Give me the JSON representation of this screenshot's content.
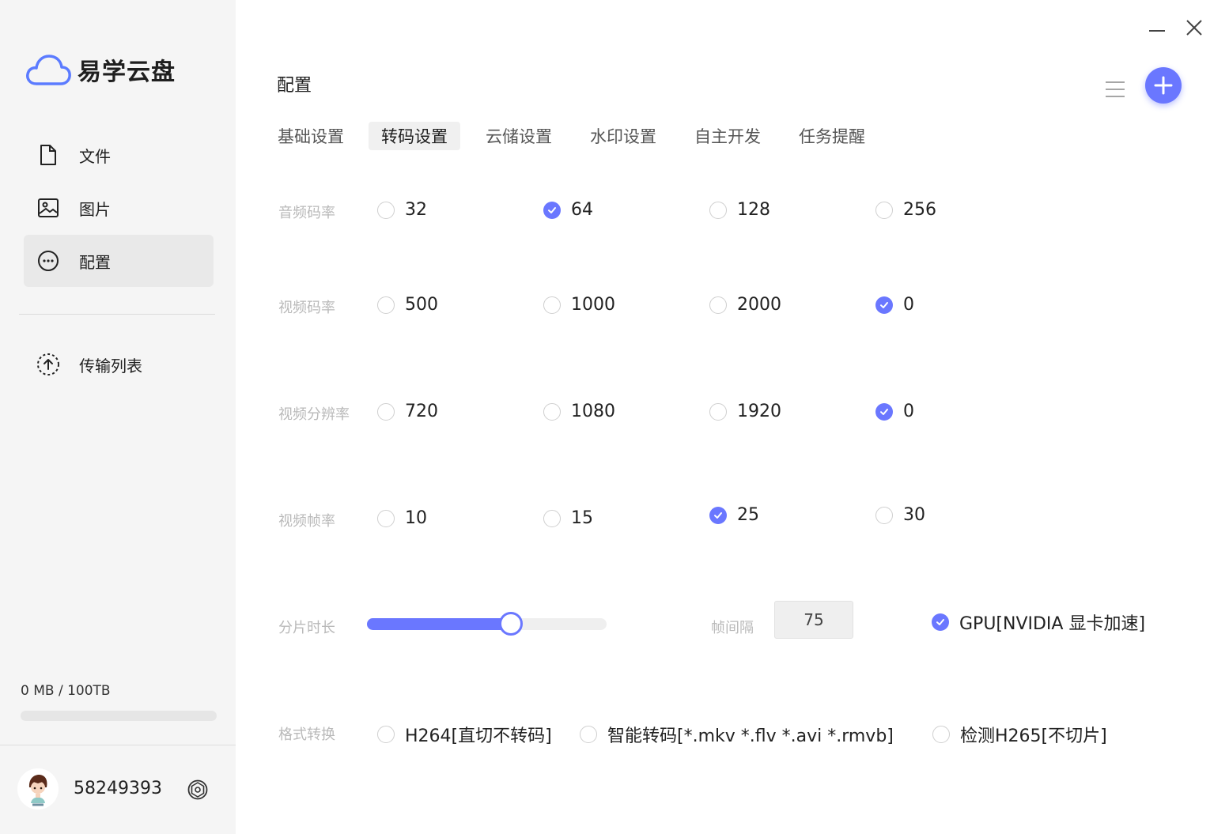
{
  "app": {
    "name": "易学云盘"
  },
  "sidebar": {
    "items": [
      {
        "label": "文件",
        "icon": "file-icon"
      },
      {
        "label": "图片",
        "icon": "image-icon"
      },
      {
        "label": "配置",
        "icon": "more-circle-icon"
      }
    ],
    "transfer": {
      "label": "传输列表",
      "icon": "upload-icon"
    },
    "storage": {
      "text": "0 MB / 100TB",
      "used_fraction": 0
    },
    "user": {
      "id": "58249393"
    }
  },
  "header": {
    "title": "配置"
  },
  "tabs": [
    "基础设置",
    "转码设置",
    "云储设置",
    "水印设置",
    "自主开发",
    "任务提醒"
  ],
  "active_tab": 1,
  "settings": {
    "audio_bitrate": {
      "label": "音频码率",
      "options": [
        "32",
        "64",
        "128",
        "256"
      ],
      "selected": 1
    },
    "video_bitrate": {
      "label": "视频码率",
      "options": [
        "500",
        "1000",
        "2000",
        "0"
      ],
      "selected": 3
    },
    "video_resolution": {
      "label": "视频分辨率",
      "options": [
        "720",
        "1080",
        "1920",
        "0"
      ],
      "selected": 3
    },
    "video_framerate": {
      "label": "视频帧率",
      "options": [
        "10",
        "15",
        "25",
        "30"
      ],
      "selected": 2
    },
    "segment_duration": {
      "label": "分片时长",
      "value_fraction": 0.6
    },
    "frame_interval": {
      "label": "帧间隔",
      "value": "75"
    },
    "gpu": {
      "label": "GPU[NVIDIA 显卡加速]",
      "checked": true
    },
    "format_conversion": {
      "label": "格式转换",
      "options": [
        "H264[直切不转码]",
        "智能转码[*.mkv *.flv *.avi *.rmvb]",
        "检测H265[不切片]"
      ]
    }
  },
  "colors": {
    "accent": "#6a77ff"
  }
}
